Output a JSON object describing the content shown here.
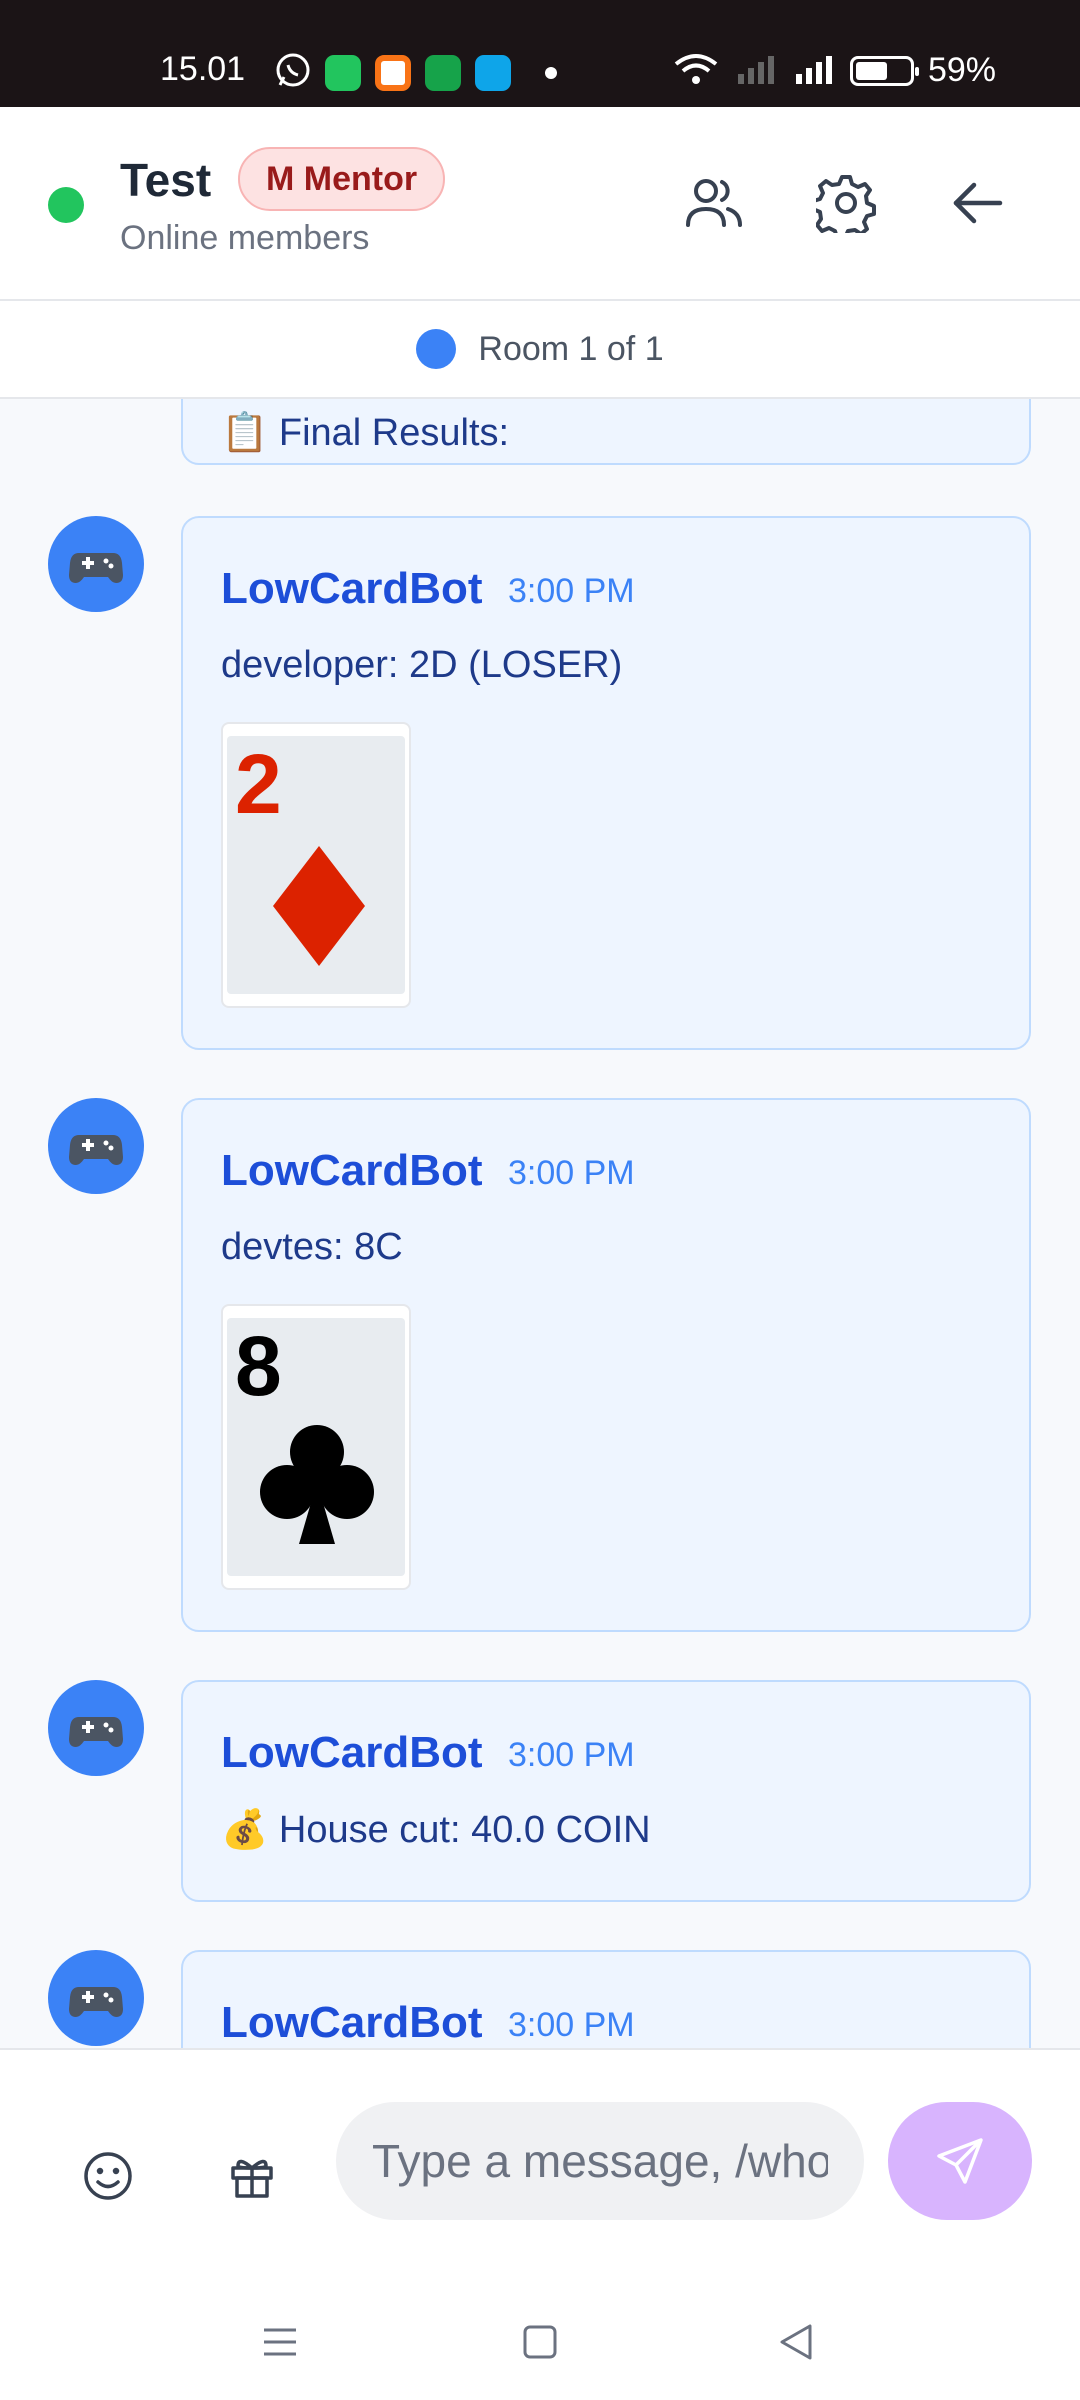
{
  "status_bar": {
    "time": "15.01",
    "battery_text": "59%",
    "battery_level": 0.59,
    "notification_icons": [
      "whatsapp-icon",
      "app-green-icon",
      "app-orange-icon",
      "messages-icon",
      "app-blue-icon"
    ]
  },
  "header": {
    "title": "Test",
    "role_badge": "M Mentor",
    "subtitle": "Online members",
    "status_color": "#22c55e",
    "actions": [
      "users-icon",
      "gear-icon",
      "back-arrow-icon"
    ]
  },
  "room_indicator": {
    "text": "Room 1 of 1",
    "dot_color": "#3b82f6"
  },
  "messages": [
    {
      "text": "📋 Final Results:"
    },
    {
      "sender": "LowCardBot",
      "time": "3:00 PM",
      "text": "developer: 2D (LOSER)",
      "card": {
        "rank": "2",
        "suit": "diamond",
        "color": "#dc2200"
      }
    },
    {
      "sender": "LowCardBot",
      "time": "3:00 PM",
      "text": "devtes: 8C",
      "card": {
        "rank": "8",
        "suit": "club",
        "color": "#000000"
      }
    },
    {
      "sender": "LowCardBot",
      "time": "3:00 PM",
      "text": "💰 House cut: 40.0 COIN"
    },
    {
      "sender": "LowCardBot",
      "time": "3:00 PM"
    }
  ],
  "input_bar": {
    "placeholder": "Type a message, /whois...",
    "send_color": "#d8b4fe"
  },
  "colors": {
    "accent": "#3b82f6",
    "bubble_bg": "#eef5ff",
    "sender": "#1d4ed8"
  }
}
